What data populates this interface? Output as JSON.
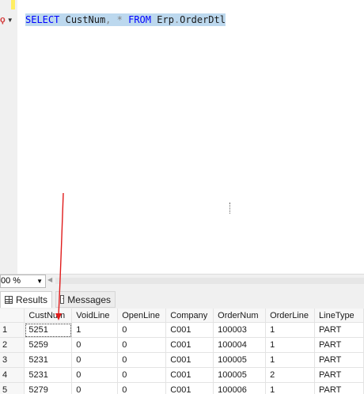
{
  "editor": {
    "query_tokens": {
      "select": "SELECT",
      "column": "CustNum",
      "comma": ",",
      "star": "*",
      "from": "FROM",
      "schema": "Erp",
      "dot": ".",
      "table": "OrderDtl"
    }
  },
  "zoom": {
    "value": "00 %"
  },
  "tabs": [
    {
      "label": "Results",
      "icon": "grid-icon"
    },
    {
      "label": "Messages",
      "icon": "messages-icon"
    }
  ],
  "results": {
    "columns": [
      "CustNum",
      "VoidLine",
      "OpenLine",
      "Company",
      "OrderNum",
      "OrderLine",
      "LineType"
    ],
    "rows": [
      {
        "n": "1",
        "cells": [
          "5251",
          "1",
          "0",
          "C001",
          "100003",
          "1",
          "PART"
        ]
      },
      {
        "n": "2",
        "cells": [
          "5259",
          "0",
          "0",
          "C001",
          "100004",
          "1",
          "PART"
        ]
      },
      {
        "n": "3",
        "cells": [
          "5231",
          "0",
          "0",
          "C001",
          "100005",
          "1",
          "PART"
        ]
      },
      {
        "n": "4",
        "cells": [
          "5231",
          "0",
          "0",
          "C001",
          "100005",
          "2",
          "PART"
        ]
      },
      {
        "n": "5",
        "cells": [
          "5279",
          "0",
          "0",
          "C001",
          "100006",
          "1",
          "PART"
        ]
      }
    ]
  },
  "colors": {
    "annotation_arrow": "#e01b1b",
    "selection": "#bcd8ee",
    "keyword": "#0000ff"
  }
}
